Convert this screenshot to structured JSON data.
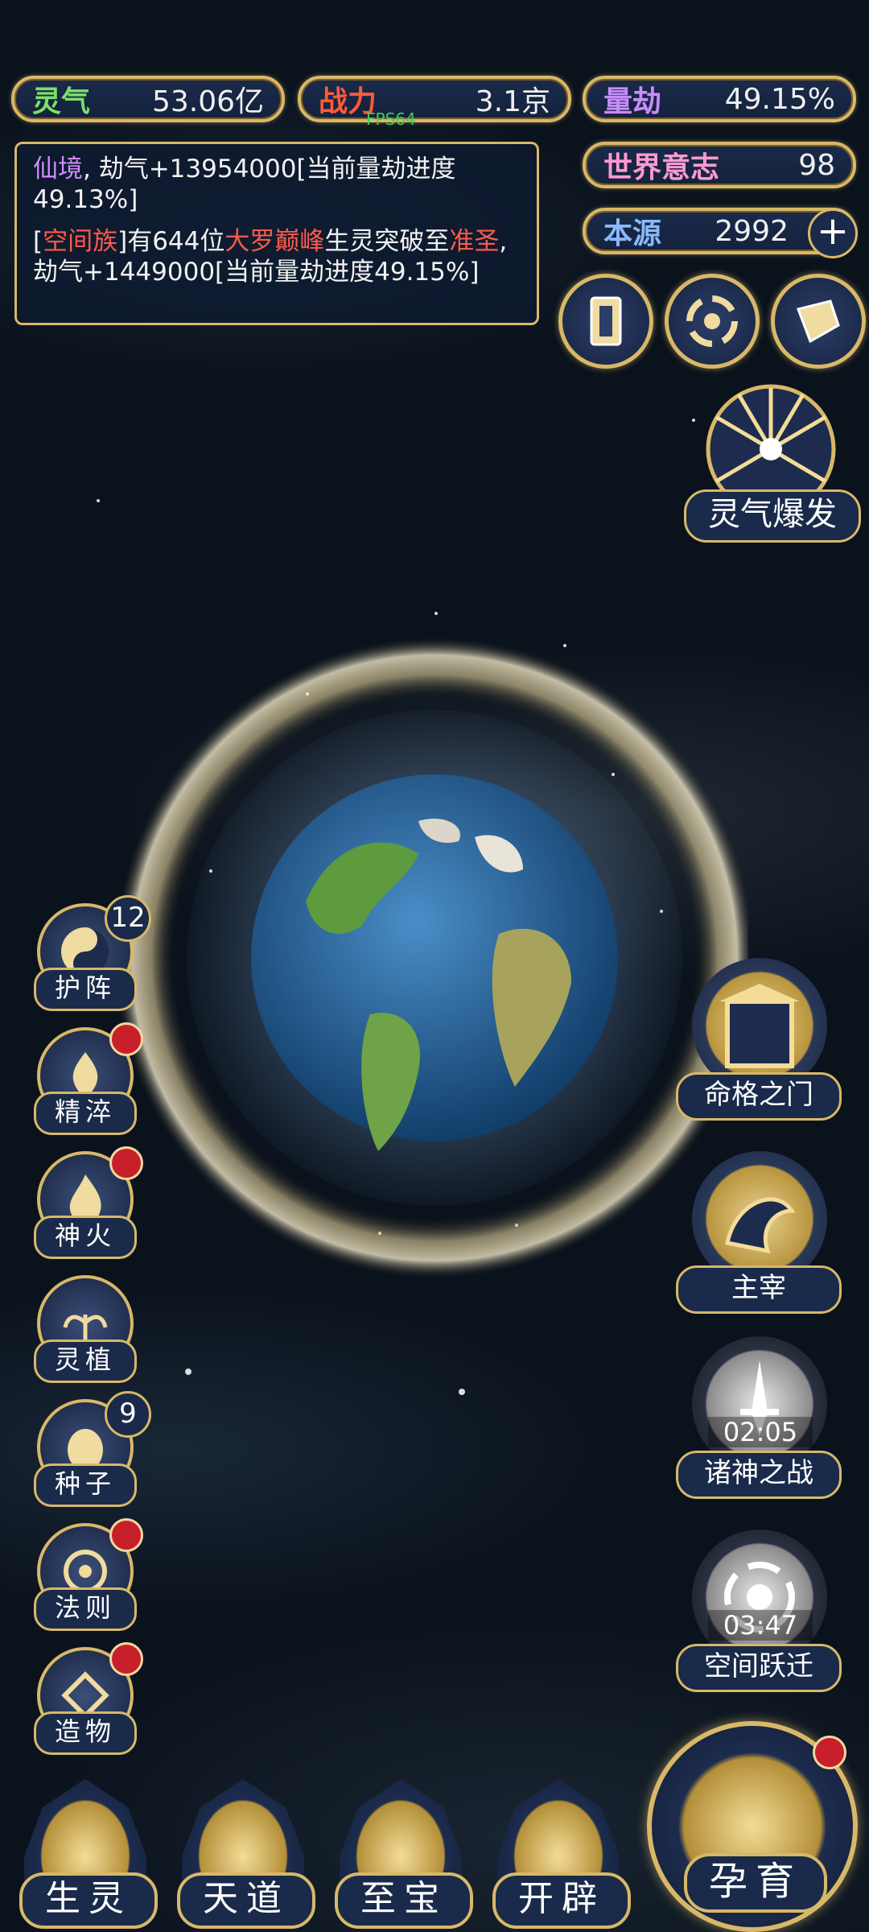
{
  "top_stats": {
    "lingqi": {
      "label": "灵气",
      "value": "53.06亿"
    },
    "zhanli": {
      "label": "战力",
      "value": "3.1京"
    },
    "liangjie": {
      "label": "量劫",
      "value": "49.15%"
    },
    "shijie_yizhi": {
      "label": "世界意志",
      "value": "98"
    },
    "benyuan": {
      "label": "本源",
      "value": "2992"
    }
  },
  "fps_text": "FPS64",
  "log": {
    "line1_realm": "仙境",
    "line1_rest": ", 劫气+13954000[当前量劫进度49.13%]",
    "line2_open": "[",
    "line2_clan": "空间族",
    "line2_mid": "]有644位",
    "line2_rank": "大罗巅峰",
    "line2_mid2": "生灵突破至",
    "line2_target": "准圣",
    "line2_rest": ", 劫气+1449000[当前量劫进度49.15%]"
  },
  "top_buttons": [
    {
      "icon": "card-icon"
    },
    {
      "icon": "vortex-icon"
    },
    {
      "icon": "scroll-icon"
    }
  ],
  "burst_label": "灵气爆发",
  "left_menu": [
    {
      "label": "护阵",
      "badge": "12",
      "icon": "yinyang-icon"
    },
    {
      "label": "精淬",
      "dot": true,
      "icon": "flame-lotus-icon"
    },
    {
      "label": "神火",
      "dot": true,
      "icon": "fire-icon"
    },
    {
      "label": "灵植",
      "icon": "plant-icon"
    },
    {
      "label": "种子",
      "badge": "9",
      "icon": "seed-icon"
    },
    {
      "label": "法则",
      "dot": true,
      "icon": "law-icon"
    },
    {
      "label": "造物",
      "dot": true,
      "icon": "creation-icon"
    }
  ],
  "right_menu": [
    {
      "label": "命格之门",
      "icon": "gate-icon"
    },
    {
      "label": "主宰",
      "icon": "dragon-icon"
    },
    {
      "label": "诸神之战",
      "timer": "02:05",
      "icon": "sword-icon"
    },
    {
      "label": "空间跃迁",
      "timer": "03:47",
      "icon": "spiral-icon"
    }
  ],
  "bottom_menu": [
    {
      "label": "生灵",
      "icon": "phoenix-icon"
    },
    {
      "label": "天道",
      "icon": "wave-icon"
    },
    {
      "label": "至宝",
      "icon": "treasure-icon"
    },
    {
      "label": "开辟",
      "icon": "axe-icon"
    }
  ],
  "yuyu_label": "孕育"
}
